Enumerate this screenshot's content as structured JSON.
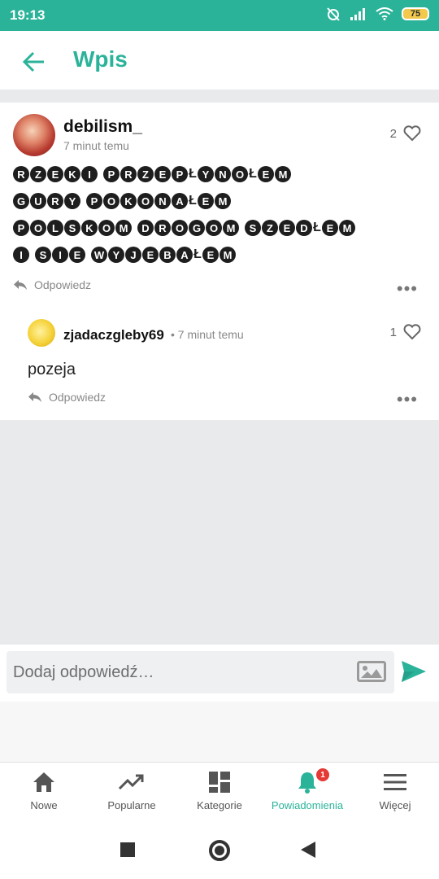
{
  "status": {
    "time": "19:13",
    "battery": "75"
  },
  "header": {
    "title": "Wpis"
  },
  "post": {
    "author": "debilism_",
    "time": "7 minut temu",
    "likes": "2",
    "lines": [
      [
        "RZEKI",
        "PRZEPŁYNOŁEM"
      ],
      [
        "GURY",
        "POKONAŁEM"
      ],
      [
        "POLSKOM",
        "DROGOM",
        "SZEDŁEM"
      ],
      [
        "I",
        "SIE",
        "WYJEBAŁEM"
      ]
    ],
    "reply_label": "Odpowiedz"
  },
  "comment": {
    "author": "zjadaczgleby69",
    "time": "• 7 minut temu",
    "likes": "1",
    "text": "pozeja",
    "reply_label": "Odpowiedz"
  },
  "input": {
    "placeholder": "Dodaj odpowiedź…"
  },
  "nav": {
    "items": [
      {
        "label": "Nowe",
        "icon": "home-icon"
      },
      {
        "label": "Popularne",
        "icon": "trending-icon"
      },
      {
        "label": "Kategorie",
        "icon": "grid-icon"
      },
      {
        "label": "Powiadomienia",
        "icon": "bell-icon",
        "badge": "1",
        "active": true
      },
      {
        "label": "Więcej",
        "icon": "menu-icon"
      }
    ]
  },
  "colors": {
    "accent": "#2bb39a",
    "badge": "#e53935"
  }
}
